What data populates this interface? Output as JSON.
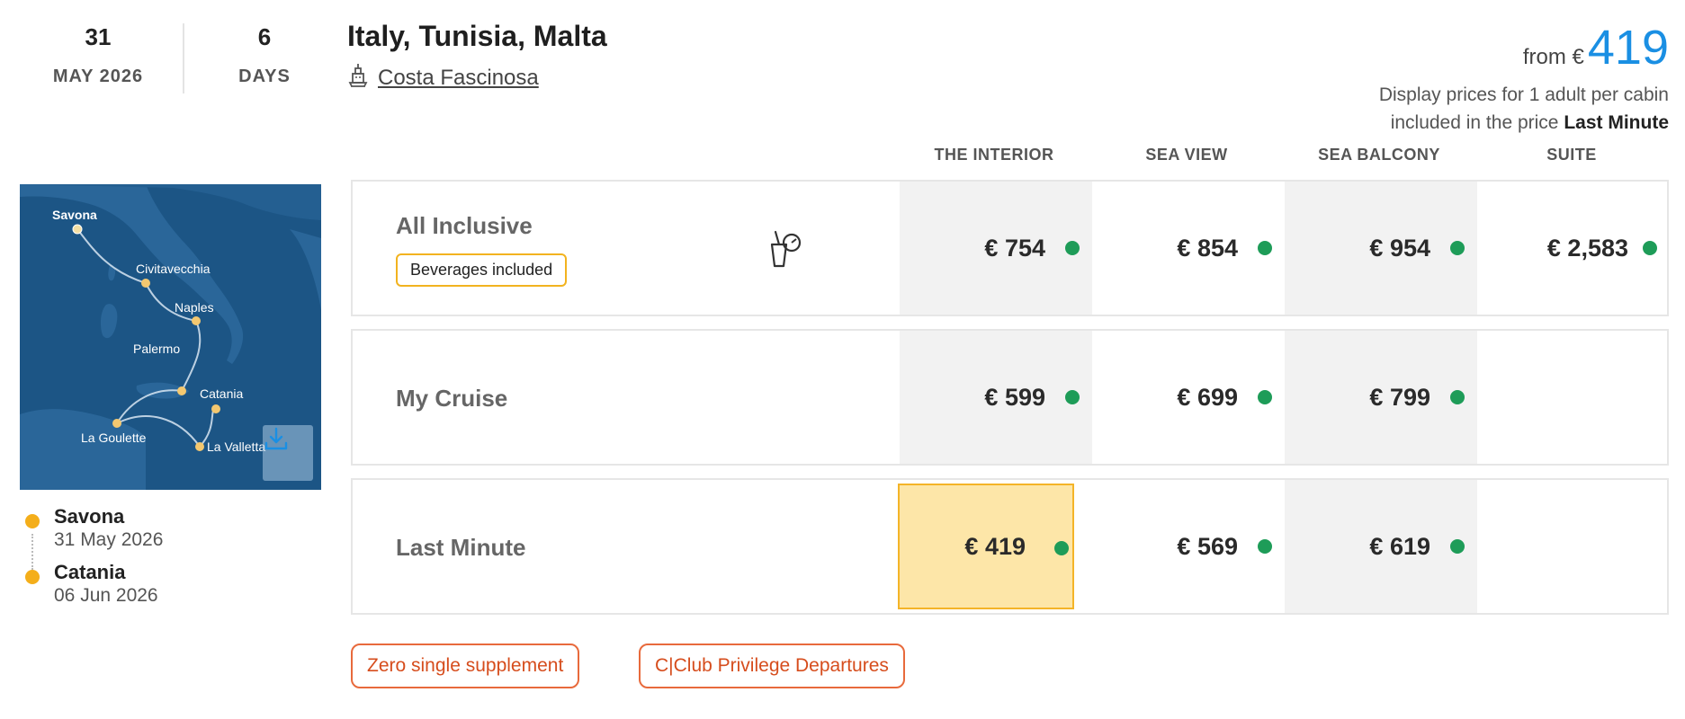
{
  "header": {
    "date_day": "31",
    "date_month_year": "MAY 2026",
    "duration_value": "6",
    "duration_unit": "DAYS",
    "title": "Italy, Tunisia, Malta",
    "ship_name": "Costa Fascinosa",
    "price_from_label": "from €",
    "price_from_amount": "419",
    "price_note_line1": "Display prices for 1 adult per cabin",
    "price_note_line2_prefix": "included in the price",
    "price_note_line2_bold": "Last Minute"
  },
  "map": {
    "ports": [
      "Savona",
      "Civitavecchia",
      "Naples",
      "Palermo",
      "Catania",
      "La Goulette",
      "La Valletta"
    ],
    "download_icon": "download-icon"
  },
  "itinerary": {
    "start": {
      "port": "Savona",
      "date": "31 May 2026"
    },
    "end": {
      "port": "Catania",
      "date": "06 Jun 2026"
    }
  },
  "cabins": {
    "headers": [
      "THE INTERIOR",
      "SEA VIEW",
      "SEA BALCONY",
      "SUITE"
    ]
  },
  "rates": [
    {
      "name": "All Inclusive",
      "badge": "Beverages included",
      "icon": "beverage-icon",
      "prices": [
        "€ 754",
        "€ 854",
        "€ 954",
        "€ 2,583"
      ]
    },
    {
      "name": "My Cruise",
      "prices": [
        "€ 599",
        "€ 699",
        "€ 799",
        ""
      ]
    },
    {
      "name": "Last Minute",
      "prices": [
        "€ 419",
        "€ 569",
        "€ 619",
        ""
      ]
    }
  ],
  "tags": [
    "Zero single supplement",
    "C|Club Privilege Departures"
  ],
  "colors": {
    "accent_blue": "#1a8fe3",
    "available_green": "#1e9c58",
    "highlight_yellow": "#fde6a8",
    "tag_orange": "#e86a3c",
    "badge_yellow": "#f2b31f",
    "map_sea": "#1c5585"
  }
}
